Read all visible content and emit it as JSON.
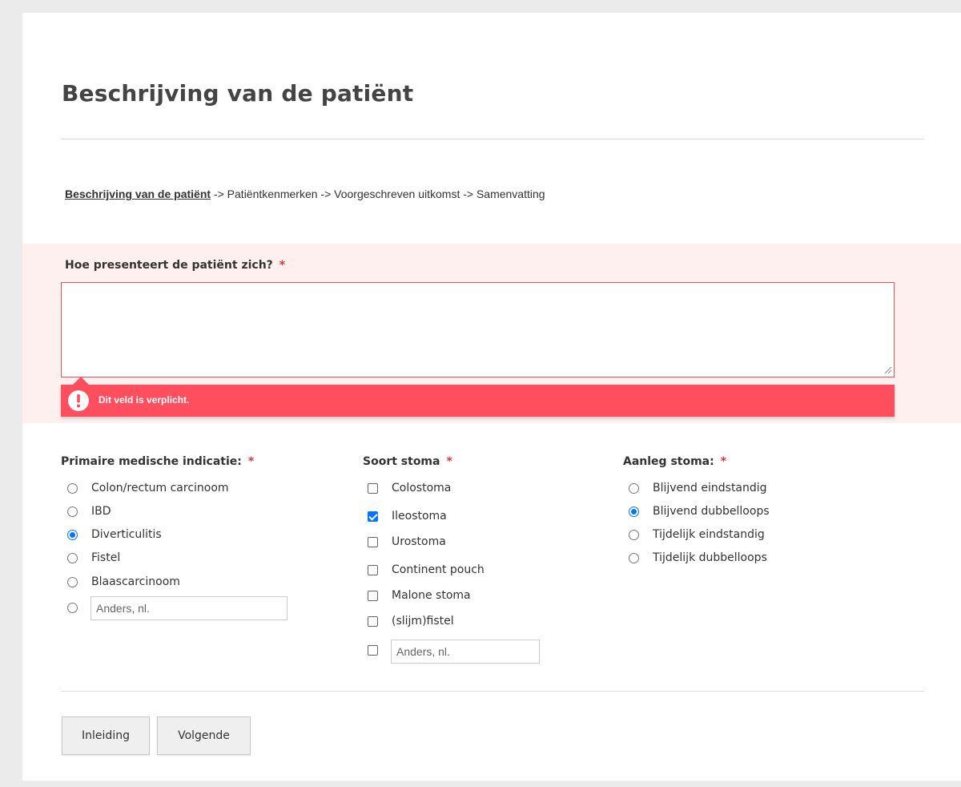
{
  "page": {
    "title": "Beschrijving van de patiënt"
  },
  "steps": {
    "active": "Beschrijving van de patiënt",
    "rest": " -> Patiëntkenmerken -> Voorgeschreven uitkomst -> Samenvatting"
  },
  "question": {
    "label": "Hoe presenteert de patiënt zich?",
    "required_mark": "*",
    "value": "",
    "error": "Dit veld is verplicht."
  },
  "indicatie": {
    "label": "Primaire medische indicatie:",
    "required_mark": "*",
    "options": [
      {
        "label": "Colon/rectum carcinoom",
        "checked": false
      },
      {
        "label": "IBD",
        "checked": false
      },
      {
        "label": "Diverticulitis",
        "checked": true
      },
      {
        "label": "Fistel",
        "checked": false
      },
      {
        "label": "Blaascarcinoom",
        "checked": false
      }
    ],
    "other_placeholder": "Anders, nl."
  },
  "stoma": {
    "label": "Soort stoma",
    "required_mark": "*",
    "options": [
      {
        "label": "Colostoma",
        "checked": false
      },
      {
        "label": "Ileostoma",
        "checked": true
      },
      {
        "label": "Urostoma",
        "checked": false
      },
      {
        "label": "Continent pouch",
        "checked": false
      },
      {
        "label": "Malone stoma",
        "checked": false
      },
      {
        "label": "(slijm)fistel",
        "checked": false
      }
    ],
    "other_placeholder": "Anders, nl."
  },
  "aanleg": {
    "label": "Aanleg stoma:",
    "required_mark": "*",
    "options": [
      {
        "label": "Blijvend eindstandig",
        "checked": false
      },
      {
        "label": "Blijvend dubbelloops",
        "checked": true
      },
      {
        "label": "Tijdelijk eindstandig",
        "checked": false
      },
      {
        "label": "Tijdelijk dubbelloops",
        "checked": false
      }
    ]
  },
  "buttons": {
    "back": "Inleiding",
    "next": "Volgende"
  },
  "colors": {
    "error": "#ff4f5e",
    "error_bg": "#fff0f0",
    "required": "#e8323c",
    "accent": "#0075ff"
  }
}
